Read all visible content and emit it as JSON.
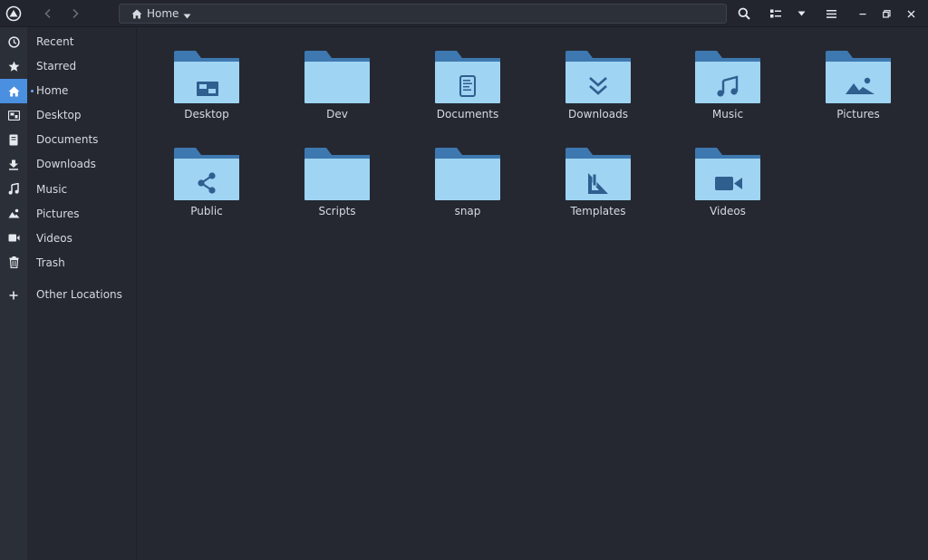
{
  "header": {
    "path_label": "Home",
    "icons": [
      "app-logo-icon",
      "back-icon",
      "forward-icon",
      "home-icon",
      "chevron-down-icon",
      "search-icon",
      "view-list-icon",
      "view-options-chevron-icon",
      "hamburger-menu-icon",
      "minimize-icon",
      "restore-icon",
      "close-icon"
    ]
  },
  "sidebar": {
    "items": [
      {
        "label": "Recent",
        "icon": "clock-icon"
      },
      {
        "label": "Starred",
        "icon": "star-icon"
      },
      {
        "label": "Home",
        "icon": "home-icon",
        "active": true
      },
      {
        "label": "Desktop",
        "icon": "desktop-icon"
      },
      {
        "label": "Documents",
        "icon": "document-icon"
      },
      {
        "label": "Downloads",
        "icon": "download-icon"
      },
      {
        "label": "Music",
        "icon": "music-icon"
      },
      {
        "label": "Pictures",
        "icon": "picture-icon"
      },
      {
        "label": "Videos",
        "icon": "video-icon"
      },
      {
        "label": "Trash",
        "icon": "trash-icon"
      },
      {
        "label": "Other Locations",
        "icon": "plus-icon"
      }
    ]
  },
  "folders": [
    {
      "name": "Desktop",
      "emblem": "desktop-emblem-icon"
    },
    {
      "name": "Dev",
      "emblem": ""
    },
    {
      "name": "Documents",
      "emblem": "document-emblem-icon"
    },
    {
      "name": "Downloads",
      "emblem": "download-emblem-icon"
    },
    {
      "name": "Music",
      "emblem": "music-emblem-icon"
    },
    {
      "name": "Pictures",
      "emblem": "picture-emblem-icon"
    },
    {
      "name": "Public",
      "emblem": "share-emblem-icon"
    },
    {
      "name": "Scripts",
      "emblem": ""
    },
    {
      "name": "snap",
      "emblem": ""
    },
    {
      "name": "Templates",
      "emblem": "template-emblem-icon"
    },
    {
      "name": "Videos",
      "emblem": "video-emblem-icon"
    }
  ],
  "colors": {
    "accent": "#4a8fe0",
    "folder_front": "#9fd4f3",
    "folder_back": "#3e78b0",
    "emblem": "#2e5f8f"
  }
}
